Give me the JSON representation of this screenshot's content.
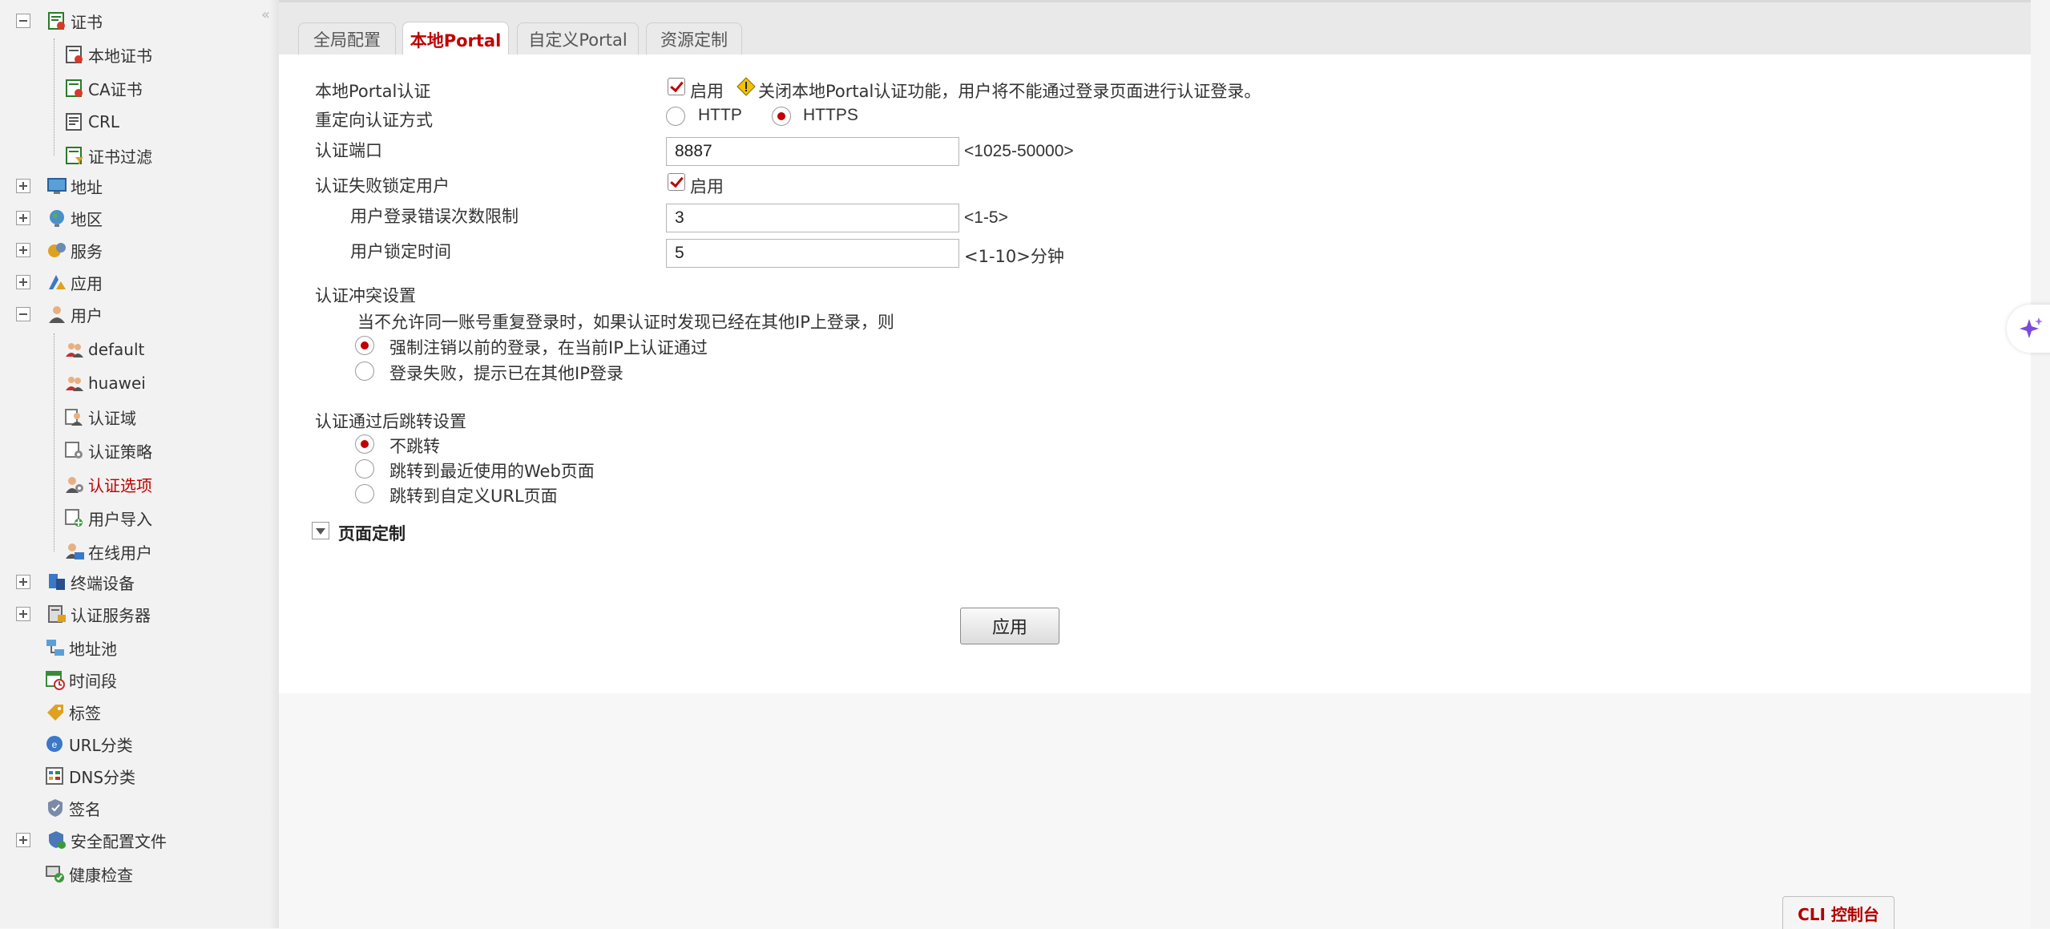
{
  "sidebar": {
    "collapse_glyph": "«",
    "items": [
      {
        "label": "证书",
        "icon": "certificate-icon"
      },
      {
        "label": "本地证书",
        "icon": "local-certificate-icon"
      },
      {
        "label": "CA证书",
        "icon": "ca-certificate-icon"
      },
      {
        "label": "CRL",
        "icon": "crl-icon"
      },
      {
        "label": "证书过滤",
        "icon": "certificate-filter-icon"
      },
      {
        "label": "地址",
        "icon": "address-icon"
      },
      {
        "label": "地区",
        "icon": "region-icon"
      },
      {
        "label": "服务",
        "icon": "service-icon"
      },
      {
        "label": "应用",
        "icon": "application-icon"
      },
      {
        "label": "用户",
        "icon": "user-icon"
      },
      {
        "label": "default",
        "icon": "user-group-icon"
      },
      {
        "label": "huawei",
        "icon": "user-group-icon"
      },
      {
        "label": "认证域",
        "icon": "auth-domain-icon"
      },
      {
        "label": "认证策略",
        "icon": "auth-policy-icon"
      },
      {
        "label": "认证选项",
        "icon": "auth-option-icon"
      },
      {
        "label": "用户导入",
        "icon": "user-import-icon"
      },
      {
        "label": "在线用户",
        "icon": "online-user-icon"
      },
      {
        "label": "终端设备",
        "icon": "terminal-device-icon"
      },
      {
        "label": "认证服务器",
        "icon": "auth-server-icon"
      },
      {
        "label": "地址池",
        "icon": "address-pool-icon"
      },
      {
        "label": "时间段",
        "icon": "time-range-icon"
      },
      {
        "label": "标签",
        "icon": "tag-icon"
      },
      {
        "label": "URL分类",
        "icon": "url-category-icon"
      },
      {
        "label": "DNS分类",
        "icon": "dns-category-icon"
      },
      {
        "label": "签名",
        "icon": "signature-icon"
      },
      {
        "label": "安全配置文件",
        "icon": "security-profile-icon"
      },
      {
        "label": "健康检查",
        "icon": "health-check-icon"
      }
    ]
  },
  "tabs": [
    {
      "label": "全局配置"
    },
    {
      "label": "本地Portal",
      "active": true
    },
    {
      "label": "自定义Portal"
    },
    {
      "label": "资源定制"
    }
  ],
  "form": {
    "portal_auth_label": "本地Portal认证",
    "portal_auth_enable": "启用",
    "portal_auth_warning": "关闭本地Portal认证功能，用户将不能通过登录页面进行认证登录。",
    "redirect_label": "重定向认证方式",
    "redirect_http": "HTTP",
    "redirect_https": "HTTPS",
    "redirect_selected": "HTTPS",
    "port_label": "认证端口",
    "port_value": "8887",
    "port_range": "<1025-50000>",
    "lock_label": "认证失败锁定用户",
    "lock_enable": "启用",
    "error_limit_label": "用户登录错误次数限制",
    "error_limit_value": "3",
    "error_limit_range": "<1-5>",
    "lock_time_label": "用户锁定时间",
    "lock_time_value": "5",
    "lock_time_range": "<1-10>分钟",
    "conflict_title": "认证冲突设置",
    "conflict_desc": "当不允许同一账号重复登录时，如果认证时发现已经在其他IP上登录，则",
    "conflict_opt1": "强制注销以前的登录，在当前IP上认证通过",
    "conflict_opt2": "登录失败，提示已在其他IP登录",
    "redirect_after_title": "认证通过后跳转设置",
    "redirect_after_opt1": "不跳转",
    "redirect_after_opt2": "跳转到最近使用的Web页面",
    "redirect_after_opt3": "跳转到自定义URL页面",
    "page_custom_label": "页面定制",
    "apply_label": "应用"
  },
  "footer": {
    "cli_label": "CLI 控制台"
  },
  "colors": {
    "accent": "#c00000",
    "sidebar_bg": "#f2f2f2",
    "tabbar_bg": "#e9e9e9"
  }
}
